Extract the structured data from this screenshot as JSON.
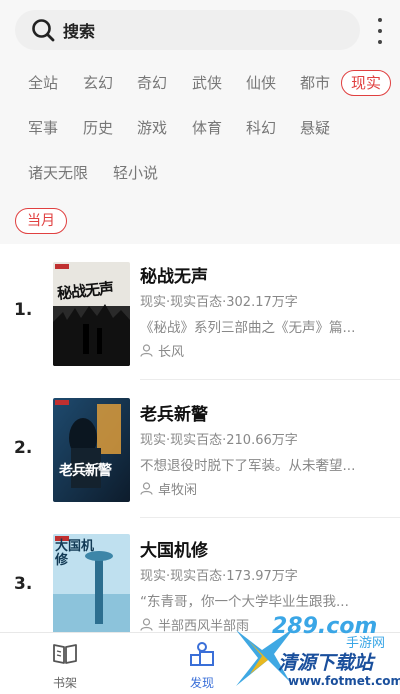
{
  "search": {
    "label": "搜索"
  },
  "categories": [
    {
      "label": "全站"
    },
    {
      "label": "玄幻"
    },
    {
      "label": "奇幻"
    },
    {
      "label": "武侠"
    },
    {
      "label": "仙侠"
    },
    {
      "label": "都市"
    },
    {
      "label": "现实"
    },
    {
      "label": "军事"
    },
    {
      "label": "历史"
    },
    {
      "label": "游戏"
    },
    {
      "label": "体育"
    },
    {
      "label": "科幻"
    },
    {
      "label": "悬疑"
    },
    {
      "label": "诸天无限"
    },
    {
      "label": "轻小说"
    }
  ],
  "active_category": "现实",
  "period": {
    "label": "当月"
  },
  "books": [
    {
      "rank": "1.",
      "title": "秘战无声",
      "meta": "现实·现实百态·302.17万字",
      "desc": "《秘战》系列三部曲之《无声》篇...",
      "author": "长风",
      "cover_text": "秘战无声"
    },
    {
      "rank": "2.",
      "title": "老兵新警",
      "meta": "现实·现实百态·210.66万字",
      "desc": "不想退役时脱下了军装。从未奢望...",
      "author": "卓牧闲",
      "cover_text": "老兵新警"
    },
    {
      "rank": "3.",
      "title": "大国机修",
      "meta": "现实·现实百态·173.97万字",
      "desc": "“东青哥，你一个大学毕业生跟我...",
      "author": "半部西风半部雨",
      "cover_text": "大国机修"
    }
  ],
  "nav": [
    {
      "label": "书架",
      "icon": "book-open-icon"
    },
    {
      "label": "发现",
      "icon": "discover-icon"
    }
  ],
  "watermark": {
    "top": "289.com",
    "sub": "手游网",
    "brand": "清源下载站",
    "url": "www.fotmet.com"
  },
  "colors": {
    "accent": "#e04040",
    "nav_active": "#3a6fd8",
    "filter_bg": "#f7f7f7"
  }
}
